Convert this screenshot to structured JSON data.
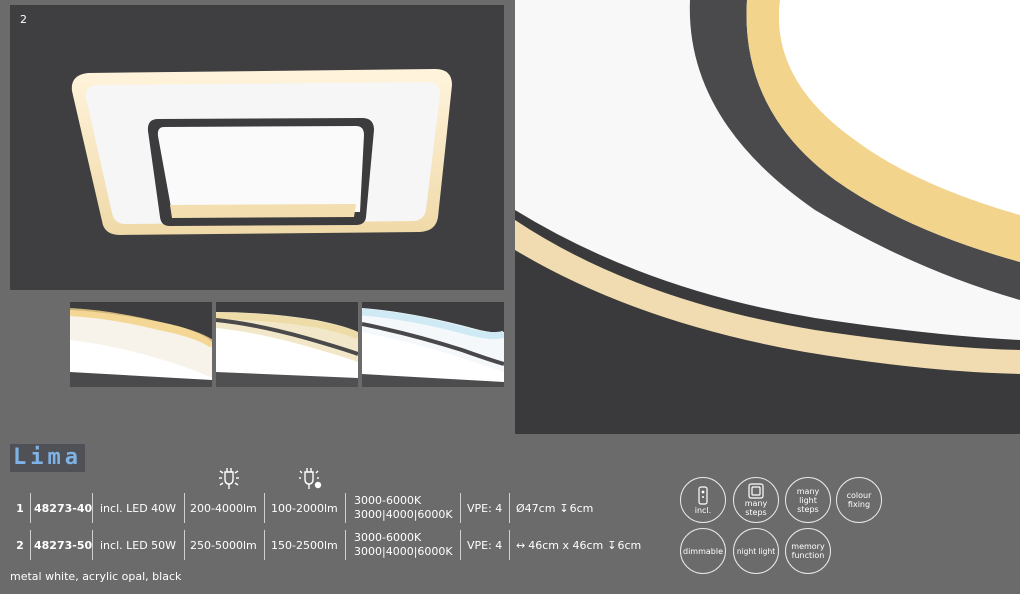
{
  "main_photo": {
    "number": "2"
  },
  "product": {
    "name": "Lima"
  },
  "specs": [
    {
      "index": "1",
      "article": "48273-40",
      "lamp": "incl. LED 40W",
      "lumen_full": "200-4000lm",
      "lumen_night": "100-2000lm",
      "color_temp_range": "3000-6000K",
      "color_temp_steps": "3000|4000|6000K",
      "vpe": "VPE: 4",
      "size_prefix": "Ø47cm",
      "size_height": "6cm"
    },
    {
      "index": "2",
      "article": "48273-50",
      "lamp": "incl. LED 50W",
      "lumen_full": "250-5000lm",
      "lumen_night": "150-2500lm",
      "color_temp_range": "3000-6000K",
      "color_temp_steps": "3000|4000|6000K",
      "vpe": "VPE: 4",
      "size_prefix": "46cm x 46cm",
      "size_height": "6cm"
    }
  ],
  "materials": "metal white, acrylic opal, black",
  "header_icons": [
    "bright-bulb-icon",
    "night-light-bulb-icon"
  ],
  "feature_badges": {
    "remote": "incl.",
    "steps": "many steps",
    "light_steps": "many light steps",
    "colour_fixing": "colour fixing",
    "dimmable": "dimmable",
    "night_light": "night light",
    "memory": "memory function"
  },
  "colors": {
    "background": "#6b6b6b",
    "title_text": "#7fb3e8",
    "warm_glow": "#f3dcaa",
    "cool_glow": "#d8eef8"
  }
}
